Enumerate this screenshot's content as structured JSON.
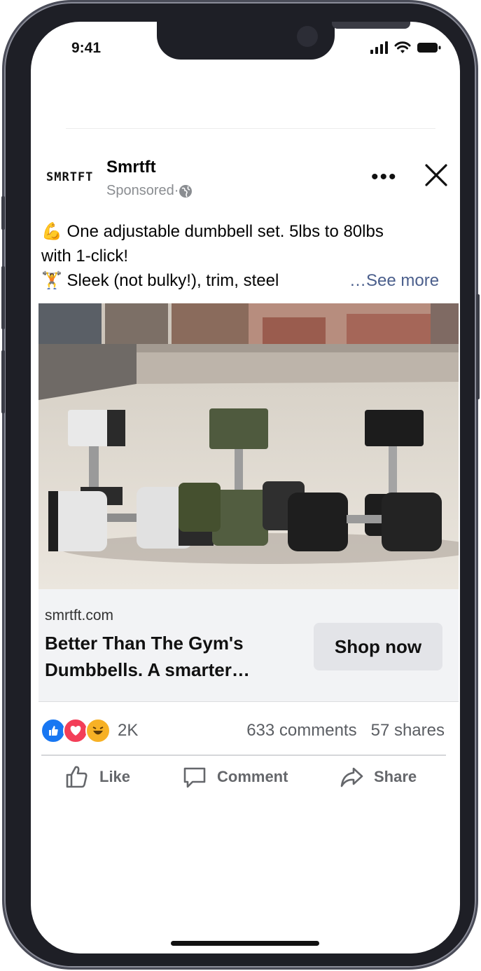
{
  "status_bar": {
    "time": "9:41"
  },
  "post": {
    "page_name": "Smrtft",
    "logo_text": "SMRTFT",
    "sponsored_label": "Sponsored",
    "sponsored_separator": " · ",
    "text_line1": "💪 One adjustable dumbbell set. 5lbs to 80lbs",
    "text_line2": "with 1-click!",
    "text_line3": "🏋 Sleek (not bulky!), trim, steel",
    "see_more": "…See more"
  },
  "link_preview": {
    "domain": "smrtft.com",
    "headline_line1": "Better Than The Gym's",
    "headline_line2": "Dumbbells. A smarter…",
    "cta_label": "Shop now"
  },
  "engagement": {
    "reaction_count": "2K",
    "comments": "633 comments",
    "shares": "57 shares",
    "reactions": [
      "like-reaction",
      "love-reaction",
      "haha-reaction"
    ]
  },
  "actions": {
    "like": "Like",
    "comment": "Comment",
    "share": "Share"
  },
  "colors": {
    "like_blue": "#1877f2",
    "love_red": "#f33e58",
    "haha_yellow": "#f7b125",
    "link_bg": "#f2f3f5",
    "see_more": "#4b5f8c"
  }
}
